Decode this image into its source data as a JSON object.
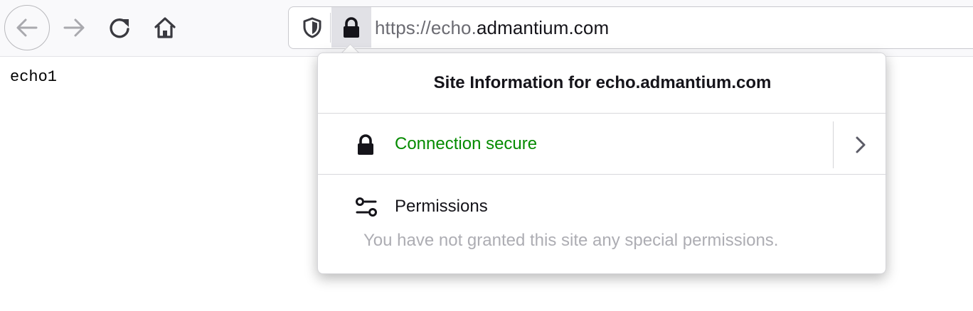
{
  "toolbar": {
    "back_icon": "arrow-left-icon",
    "forward_icon": "arrow-right-icon",
    "reload_icon": "reload-icon",
    "home_icon": "home-icon"
  },
  "urlbar": {
    "tracking_icon": "shield-icon",
    "lock_icon": "lock-icon",
    "url_scheme": "https://echo.",
    "url_domain": "admantium.com"
  },
  "page": {
    "content_text": "echo1"
  },
  "site_info": {
    "title": "Site Information for echo.admantium.com",
    "connection_label": "Connection secure",
    "connection_color": "#058b00",
    "permissions_label": "Permissions",
    "permissions_desc": "You have not granted this site any special permissions."
  }
}
